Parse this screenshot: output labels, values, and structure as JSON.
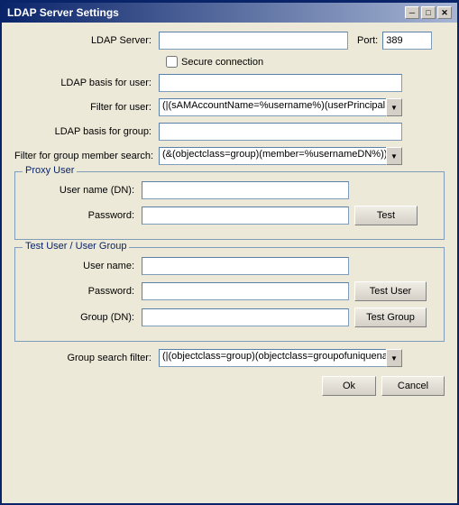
{
  "window": {
    "title": "LDAP Server Settings",
    "close_btn": "✕",
    "min_btn": "─",
    "max_btn": "□"
  },
  "form": {
    "ldap_server_label": "LDAP Server:",
    "ldap_server_value": "",
    "port_label": "Port:",
    "port_value": "389",
    "secure_label": "Secure connection",
    "ldap_basis_user_label": "LDAP basis for user:",
    "ldap_basis_user_value": "",
    "filter_user_label": "Filter for user:",
    "filter_user_value": "(|(sAMAccountName=%username%)(userPrincipalName=%",
    "ldap_basis_group_label": "LDAP basis for group:",
    "ldap_basis_group_value": "",
    "filter_group_label": "Filter for group member search:",
    "filter_group_value": "(&(objectclass=group)(member=%usernameDN%))",
    "proxy_section_title": "Proxy User",
    "proxy_username_label": "User name (DN):",
    "proxy_username_value": "",
    "proxy_password_label": "Password:",
    "proxy_password_value": "",
    "test_btn_label": "Test",
    "test_user_section_title": "Test User / User Group",
    "test_username_label": "User name:",
    "test_username_value": "",
    "test_password_label": "Password:",
    "test_password_value": "",
    "test_user_btn_label": "Test User",
    "test_group_label": "Group (DN):",
    "test_group_value": "",
    "test_group_btn_label": "Test Group",
    "group_search_label": "Group search filter:",
    "group_search_value": "(|(objectclass=group)(objectclass=groupofuniquenames))",
    "ok_btn_label": "Ok",
    "cancel_btn_label": "Cancel",
    "dropdown_arrow": "▼"
  }
}
